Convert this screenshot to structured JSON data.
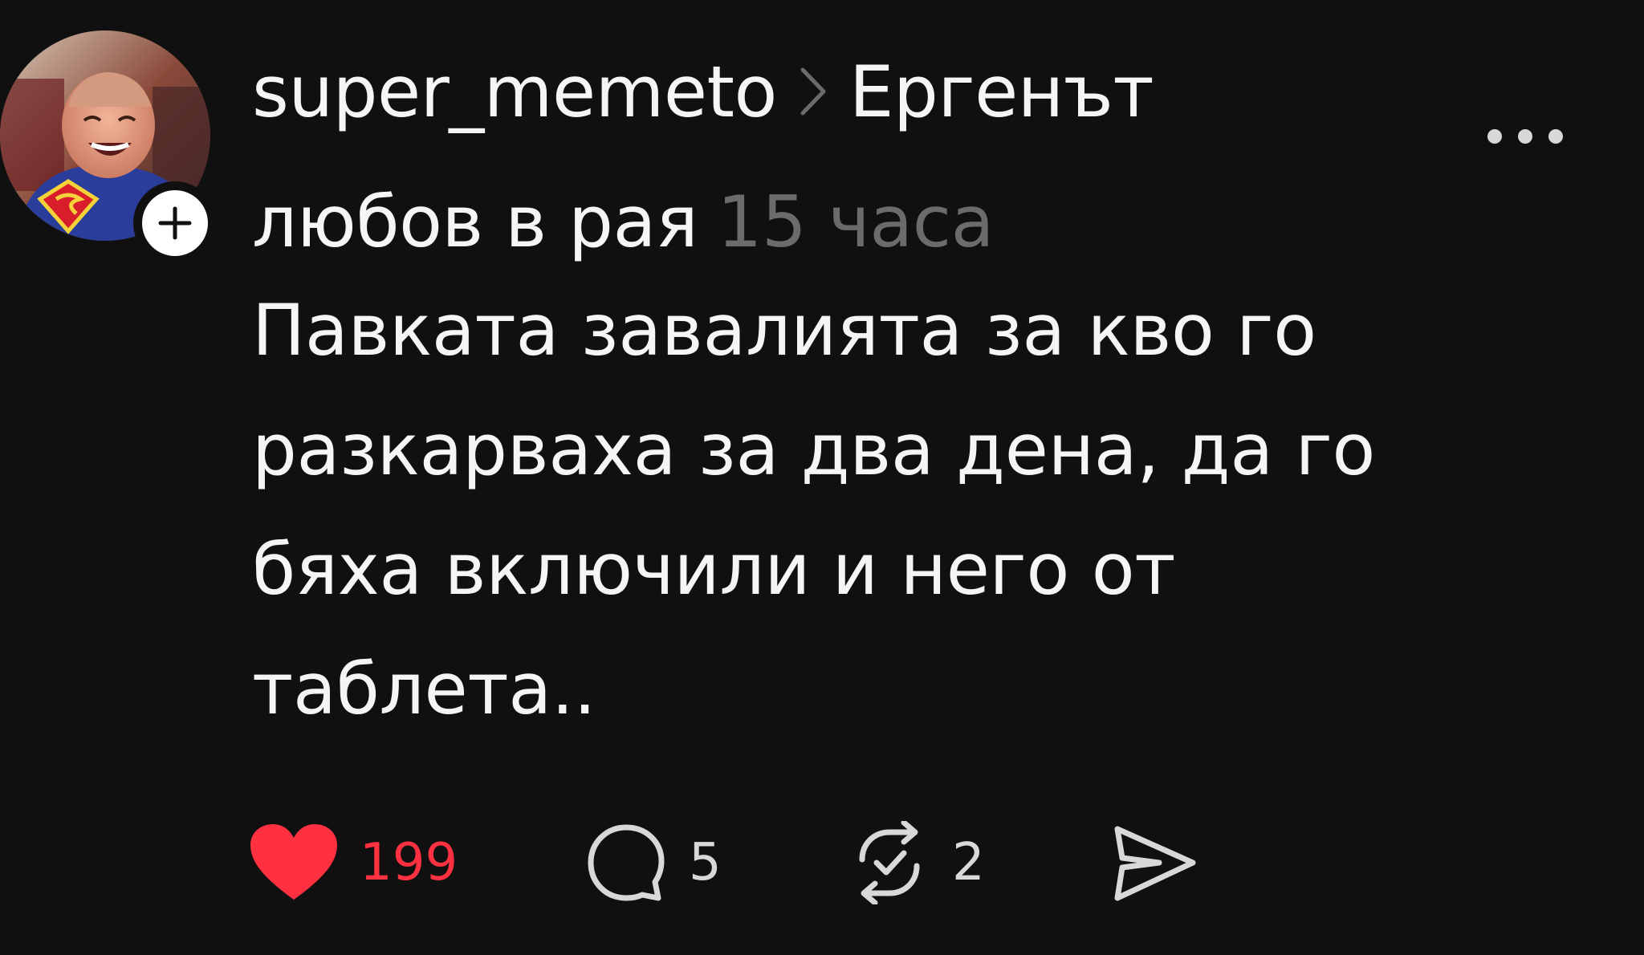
{
  "post": {
    "username": "super_memeto",
    "community_line1": "Ергенът",
    "community_line2": "любов в рая",
    "time": "15 часа",
    "text_lines": [
      "Павката завалията за кво го",
      "разкарваха за два дена, да го",
      "бяха включили и него от",
      "таблета.."
    ],
    "liked": true
  },
  "actions": {
    "likes": "199",
    "comments": "5",
    "reposts": "2"
  },
  "icons": {
    "avatar": "avatar-photo",
    "follow": "plus-icon",
    "separator": "chevron-right-icon",
    "more": "more-dots-icon",
    "like": "heart-icon",
    "comment": "comment-icon",
    "repost": "repost-icon",
    "share": "send-icon"
  },
  "colors": {
    "background": "#101010",
    "text": "#f3f5f7",
    "secondary": "#6b6b6b",
    "like": "#ff3040"
  }
}
